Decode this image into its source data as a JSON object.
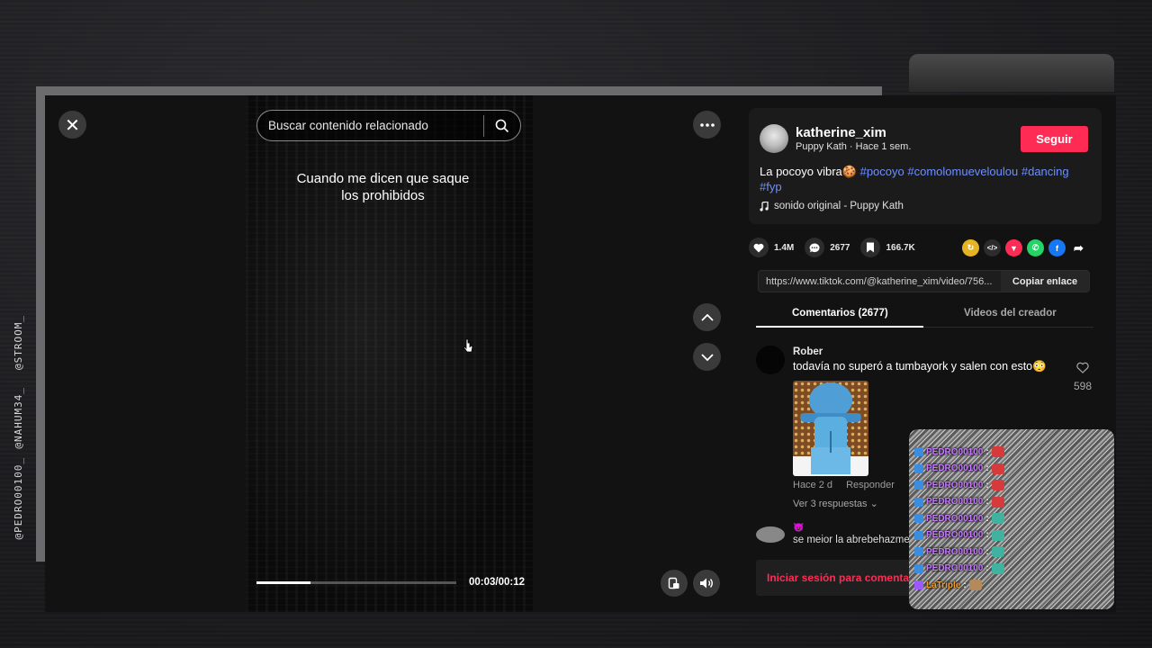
{
  "stream": {
    "credits": [
      "@PEDRO00100_",
      "@NAHUM34_",
      "@STROOM_"
    ]
  },
  "video": {
    "search_placeholder": "Buscar contenido relacionado",
    "caption_line1": "Cuando me dicen que saque",
    "caption_line2": "los prohibidos",
    "time": "00:03/00:12",
    "progress": 0.27
  },
  "profile": {
    "username": "katherine_xim",
    "subline": "Puppy Kath · Hace 1 sem.",
    "follow_label": "Seguir",
    "desc_text": "La pocoyo vibra🍪 ",
    "hashtags": [
      "#pocoyo",
      "#comolomueveloulou",
      "#dancing",
      "#fyp"
    ],
    "music": "sonido original - Puppy Kath"
  },
  "stats": {
    "likes": "1.4M",
    "comments": "2677",
    "saves": "166.7K"
  },
  "share": {
    "link": "https://www.tiktok.com/@katherine_xim/video/756...",
    "copy_label": "Copiar enlace"
  },
  "tabs": {
    "comments": "Comentarios (2677)",
    "creator_videos": "Videos del creador"
  },
  "comments": [
    {
      "name": "Rober",
      "text": "todavía no superó a tumbayork y salen con esto😳",
      "meta_time": "Hace 2 d",
      "reply_label": "Responder",
      "replies": "Ver 3 respuestas",
      "likes": "598"
    },
    {
      "name": "",
      "text": "😈",
      "text2": "se mejor la abrebehazme"
    }
  ],
  "login_prompt": "Iniciar sesión para comentar",
  "chat": {
    "messages": [
      {
        "user": "PEDRO00100",
        "emote_color": "#d63a3a"
      },
      {
        "user": "PEDRO00100",
        "emote_color": "#d63a3a"
      },
      {
        "user": "PEDRO00100",
        "emote_color": "#d63a3a"
      },
      {
        "user": "PEDRO00100",
        "emote_color": "#d63a3a"
      },
      {
        "user": "PEDRO00100",
        "emote_color": "#3fb3a0"
      },
      {
        "user": "PEDRO00100",
        "emote_color": "#3fb3a0"
      },
      {
        "user": "PEDRO00100",
        "emote_color": "#3fb3a0"
      },
      {
        "user": "PEDRO00100",
        "emote_color": "#3fb3a0"
      },
      {
        "user": "LaTriple",
        "emote_color": "#b58a5a"
      }
    ],
    "separator": ":"
  },
  "colors": {
    "accent": "#fe2c55",
    "hashtag": "#6e8fff",
    "panel": "#121212"
  },
  "icons": [
    "close-icon",
    "search-icon",
    "more-icon",
    "chevron-up-icon",
    "chevron-down-icon",
    "heart-icon",
    "comment-icon",
    "bookmark-icon",
    "music-note-icon",
    "volume-icon",
    "pip-icon"
  ]
}
